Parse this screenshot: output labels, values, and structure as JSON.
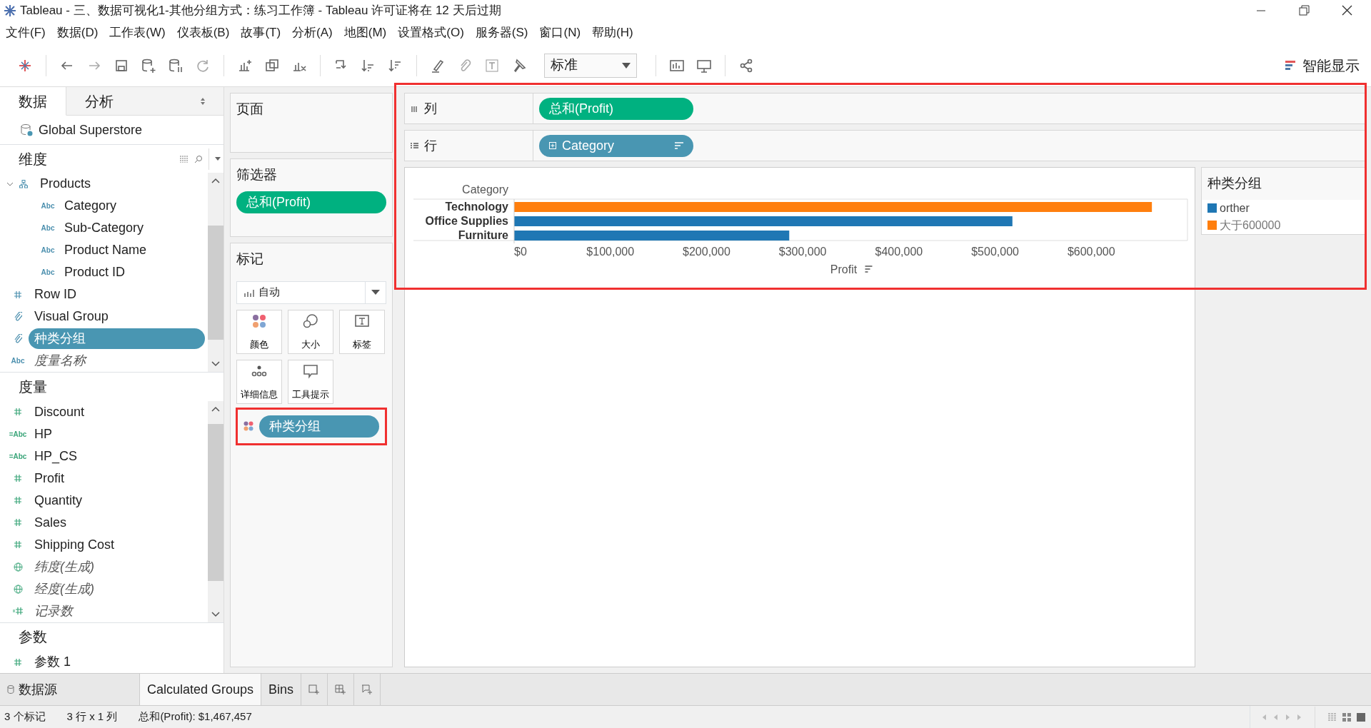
{
  "window": {
    "title": "Tableau - 三、数据可视化1-其他分组方式：练习工作簿 - Tableau 许可证将在 12 天后过期"
  },
  "menu": [
    "文件(F)",
    "数据(D)",
    "工作表(W)",
    "仪表板(B)",
    "故事(T)",
    "分析(A)",
    "地图(M)",
    "设置格式(O)",
    "服务器(S)",
    "窗口(N)",
    "帮助(H)"
  ],
  "toolbar": {
    "fit": "标准",
    "show_me": "智能显示"
  },
  "side_tabs": [
    {
      "label": "数据",
      "selected": true
    },
    {
      "label": "分析",
      "selected": false
    }
  ],
  "datasource": "Global Superstore",
  "dimensions": {
    "title": "维度",
    "items": [
      {
        "label": "Products",
        "kind": "hierarchy",
        "expanded": true,
        "selected": false,
        "generated": false,
        "children": [
          {
            "label": "Category",
            "kind": "text",
            "type_text": "Abc",
            "selected": false,
            "generated": false
          },
          {
            "label": "Sub-Category",
            "kind": "text",
            "type_text": "Abc",
            "selected": false,
            "generated": false
          },
          {
            "label": "Product Name",
            "kind": "text",
            "type_text": "Abc",
            "selected": false,
            "generated": false
          },
          {
            "label": "Product ID",
            "kind": "text",
            "type_text": "Abc",
            "selected": false,
            "generated": false
          }
        ]
      },
      {
        "label": "Row ID",
        "kind": "number",
        "selected": false,
        "generated": false
      },
      {
        "label": "Visual Group",
        "kind": "group",
        "selected": false,
        "generated": false
      },
      {
        "label": "种类分组",
        "kind": "group",
        "selected": true,
        "generated": false
      },
      {
        "label": "度量名称",
        "kind": "text",
        "type_text": "Abc",
        "selected": false,
        "generated": true
      }
    ]
  },
  "measures": {
    "title": "度量",
    "items": [
      {
        "label": "Discount",
        "kind": "number",
        "selected": false,
        "generated": false
      },
      {
        "label": "HP",
        "kind": "text",
        "type_text": "=Abc",
        "selected": false,
        "generated": false
      },
      {
        "label": "HP_CS",
        "kind": "text",
        "type_text": "=Abc",
        "selected": false,
        "generated": false
      },
      {
        "label": "Profit",
        "kind": "number",
        "selected": false,
        "generated": false
      },
      {
        "label": "Quantity",
        "kind": "number",
        "selected": false,
        "generated": false
      },
      {
        "label": "Sales",
        "kind": "number",
        "selected": false,
        "generated": false
      },
      {
        "label": "Shipping Cost",
        "kind": "number",
        "selected": false,
        "generated": false
      },
      {
        "label": "纬度(生成)",
        "kind": "globe",
        "selected": false,
        "generated": true
      },
      {
        "label": "经度(生成)",
        "kind": "globe",
        "selected": false,
        "generated": true
      },
      {
        "label": "记录数",
        "kind": "calc-number",
        "selected": false,
        "generated": true
      }
    ]
  },
  "parameters": {
    "title": "参数",
    "items": [
      {
        "label": "参数 1",
        "kind": "number",
        "selected": false,
        "generated": false
      }
    ]
  },
  "pages": {
    "title": "页面"
  },
  "filters": {
    "title": "筛选器",
    "pills": [
      {
        "label": "总和(Profit)",
        "kind": "measure"
      }
    ]
  },
  "marks": {
    "title": "标记",
    "mark_type": "自动",
    "buttons": [
      {
        "label": "颜色",
        "kind": "color"
      },
      {
        "label": "大小",
        "kind": "size"
      },
      {
        "label": "标签",
        "kind": "label"
      },
      {
        "label": "详细信息",
        "kind": "detail"
      },
      {
        "label": "工具提示",
        "kind": "tooltip"
      }
    ],
    "fields": [
      {
        "label": "种类分组",
        "kind": "color",
        "highlighted": true
      }
    ]
  },
  "shelves": {
    "highlighted": true,
    "columns": {
      "label": "列",
      "pills": [
        {
          "label": "总和(Profit)",
          "kind": "measure",
          "expandable": false,
          "sorted": false
        }
      ]
    },
    "rows": {
      "label": "行",
      "pills": [
        {
          "label": "Category",
          "kind": "dimension",
          "expandable": true,
          "sorted": true
        }
      ]
    }
  },
  "view": {
    "axis_sorted": true,
    "chart_data": {
      "type": "bar",
      "orientation": "horizontal",
      "ylabel": "Category",
      "xlabel": "Profit",
      "categories": [
        "Technology",
        "Office Supplies",
        "Furniture"
      ],
      "series": [
        {
          "name": "orther",
          "color": "#1f77b4",
          "values": [
            null,
            518000,
            286000
          ]
        },
        {
          "name": "大于600000",
          "color": "#ff7f0e",
          "values": [
            663000,
            null,
            null
          ]
        }
      ],
      "xlim": [
        0,
        700000
      ],
      "xticks": [
        {
          "value": 0,
          "label": "$0"
        },
        {
          "value": 100000,
          "label": "$100,000"
        },
        {
          "value": 200000,
          "label": "$200,000"
        },
        {
          "value": 300000,
          "label": "$300,000"
        },
        {
          "value": 400000,
          "label": "$400,000"
        },
        {
          "value": 500000,
          "label": "$500,000"
        },
        {
          "value": 600000,
          "label": "$600,000"
        }
      ]
    }
  },
  "legend": {
    "title": "种类分组"
  },
  "sheet_tabs": [
    {
      "label": "数据源",
      "kind": "datasource",
      "selected": false
    },
    {
      "label": "Calculated Groups",
      "kind": "sheet",
      "selected": true
    },
    {
      "label": "Bins",
      "kind": "sheet",
      "selected": false
    }
  ],
  "status": [
    "3 个标记",
    "3 行 x 1 列",
    "总和(Profit): $1,467,457"
  ]
}
